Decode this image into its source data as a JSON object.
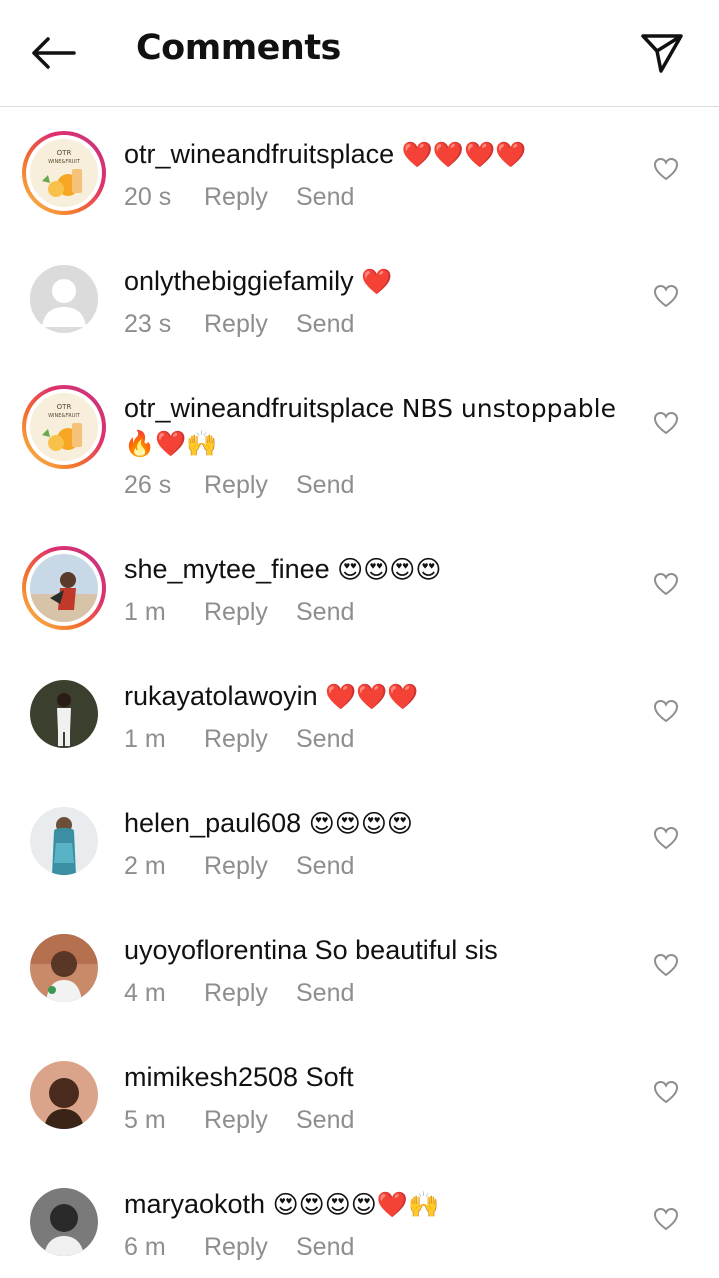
{
  "header": {
    "title": "Comments",
    "back_icon": "arrow-left-icon",
    "share_icon": "paper-plane-icon"
  },
  "actions": {
    "reply": "Reply",
    "send": "Send"
  },
  "comments": [
    {
      "username": "otr_wineandfruitsplace",
      "text": "❤️❤️❤️❤️",
      "time": "20 s",
      "avatar": "otr-logo"
    },
    {
      "username": "onlythebiggiefamily",
      "text": "❤️",
      "time": "23 s",
      "avatar": "default-user"
    },
    {
      "username": "otr_wineandfruitsplace",
      "text": "NBS unstoppable 🔥❤️🙌",
      "time": "26 s",
      "avatar": "otr-logo"
    },
    {
      "username": "she_mytee_finee",
      "text": "😍😍😍😍",
      "time": "1 m",
      "avatar": "photo"
    },
    {
      "username": "rukayatolawoyin",
      "text": "❤️❤️❤️",
      "time": "1 m",
      "avatar": "photo"
    },
    {
      "username": "helen_paul608",
      "text": "😍😍😍😍",
      "time": "2 m",
      "avatar": "photo"
    },
    {
      "username": "uyoyoflorentina",
      "text": "So beautiful sis",
      "time": "4 m",
      "avatar": "photo"
    },
    {
      "username": "mimikesh2508",
      "text": "Soft",
      "time": "5 m",
      "avatar": "photo"
    },
    {
      "username": "maryaokoth",
      "text": "😍😍😍😍❤️🙌",
      "time": "6 m",
      "avatar": "photo"
    }
  ]
}
